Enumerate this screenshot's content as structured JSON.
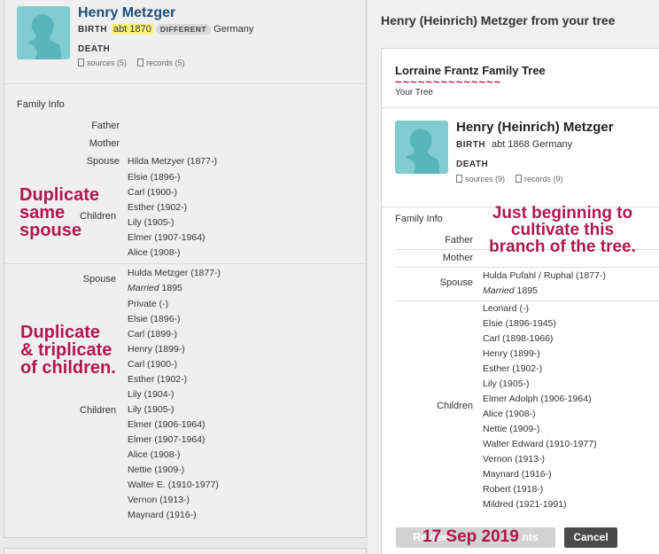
{
  "left": {
    "name": "Henry Metzger",
    "birth_label": "BIRTH",
    "birth_date": "abt 1870",
    "birth_badge": "DIFFERENT",
    "birth_place": "Germany",
    "death_label": "DEATH",
    "sources": "sources (5)",
    "records": "records (5)",
    "family_info": "Family Info",
    "father_label": "Father",
    "mother_label": "Mother",
    "spouse_label": "Spouse",
    "children_label": "Children",
    "spouse1": "Hilda Metzyer (1877-)",
    "children1": [
      "Elsie (1896-)",
      "Carl (1900-)",
      "Esther (1902-)",
      "Lily (1905-)",
      "Elmer (1907-1964)",
      "Alice (1908-)"
    ],
    "spouse2": "Hulda Metzger (1877-)",
    "married_label": "Married",
    "married_year": "1895",
    "children2": [
      "Private (-)",
      "Elsie (1896-)",
      "Carl (1899-)",
      "Henry (1899-)",
      "Carl (1900-)",
      "Esther (1902-)",
      "Lily (1904-)",
      "Lily (1905-)",
      "Elmer (1906-1964)",
      "Elmer (1907-1964)",
      "Alice (1908-)",
      "Nettie (1909-)",
      "Walter E. (1910-1977)",
      "Vernon (1913-)",
      "Maynard (1916-)"
    ]
  },
  "right": {
    "header": "Henry (Heinrich) Metzger from your tree",
    "tree_name": "Lorraine Frantz Family Tree",
    "tree_sub": "Your Tree",
    "name": "Henry (Heinrich) Metzger",
    "birth_label": "BIRTH",
    "birth_value": "abt 1868 Germany",
    "death_label": "DEATH",
    "sources": "sources (9)",
    "records": "records (9)",
    "family_info": "Family Info",
    "father_label": "Father",
    "mother_label": "Mother",
    "spouse_label": "Spouse",
    "children_label": "Children",
    "spouse": "Hulda Pufahl / Ruphal (1877-)",
    "married_label": "Married",
    "married_year": "1895",
    "children": [
      "Leonard (-)",
      "Elsie (1896-1945)",
      "Carl (1898-1966)",
      "Henry (1899-)",
      "Esther (1902-)",
      "Lily (1905-)",
      "Elmer Adolph (1906-1964)",
      "Alice (1908-)",
      "Nettie (1909-)",
      "Walter Edward (1910-1977)",
      "Vernon (1913-)",
      "Maynard (1916-)",
      "Robert (1918-)",
      "Mildred (1921-1991)"
    ],
    "review_button": "Review",
    "review_button_tail": "nts",
    "cancel_button": "Cancel"
  },
  "annotations": {
    "dup_spouse": [
      "Duplicate",
      "same",
      "spouse"
    ],
    "dup_children": [
      "Duplicate",
      "& triplicate",
      "of children."
    ],
    "cultivate": [
      "Just beginning to",
      "cultivate this",
      "branch of the tree."
    ],
    "date": "17 Sep 2019"
  },
  "colors": {
    "name_blue": "#1d4f7a",
    "annotation": "#b0174f",
    "avatar": "#7fcdd1",
    "highlight": "#f8f27a"
  }
}
